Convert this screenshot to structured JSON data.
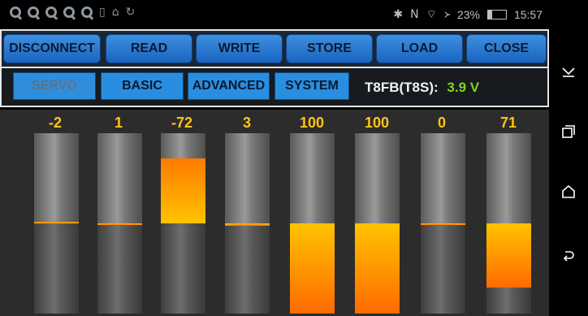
{
  "status": {
    "left_icons": [
      "q-icon",
      "q-icon",
      "q-icon",
      "q-icon",
      "q-icon",
      "sim-icon",
      "lock-icon",
      "sync-icon"
    ],
    "bluetooth": "✱",
    "nfc": "N",
    "wifi": "⌔",
    "signal": "᚛",
    "battery_text": "23%",
    "battery_level": 0.23,
    "time": "15:57"
  },
  "toolbar": {
    "buttons": [
      {
        "label": "DISCONNECT"
      },
      {
        "label": "READ"
      },
      {
        "label": "WRITE"
      },
      {
        "label": "STORE"
      },
      {
        "label": "LOAD"
      },
      {
        "label": "CLOSE"
      }
    ]
  },
  "tabs": {
    "items": [
      {
        "label": "SERVO",
        "active": true
      },
      {
        "label": "BASIC"
      },
      {
        "label": "ADVANCED"
      },
      {
        "label": "SYSTEM"
      }
    ],
    "model": "T8FB(T8S):",
    "voltage": "3.9 V"
  },
  "channels": [
    {
      "value": "-2"
    },
    {
      "value": "1"
    },
    {
      "value": "-72"
    },
    {
      "value": "3"
    },
    {
      "value": "100"
    },
    {
      "value": "100"
    },
    {
      "value": "0"
    },
    {
      "value": "71"
    }
  ],
  "colors": {
    "accent_blue": "#2a8ee0",
    "value_yellow": "#ffc41a",
    "voltage_green": "#7ed321",
    "fill_orange": "#ff8c00"
  },
  "navbar": {
    "icons": [
      "collapse-icon",
      "recents-icon",
      "home-icon",
      "back-icon"
    ]
  }
}
